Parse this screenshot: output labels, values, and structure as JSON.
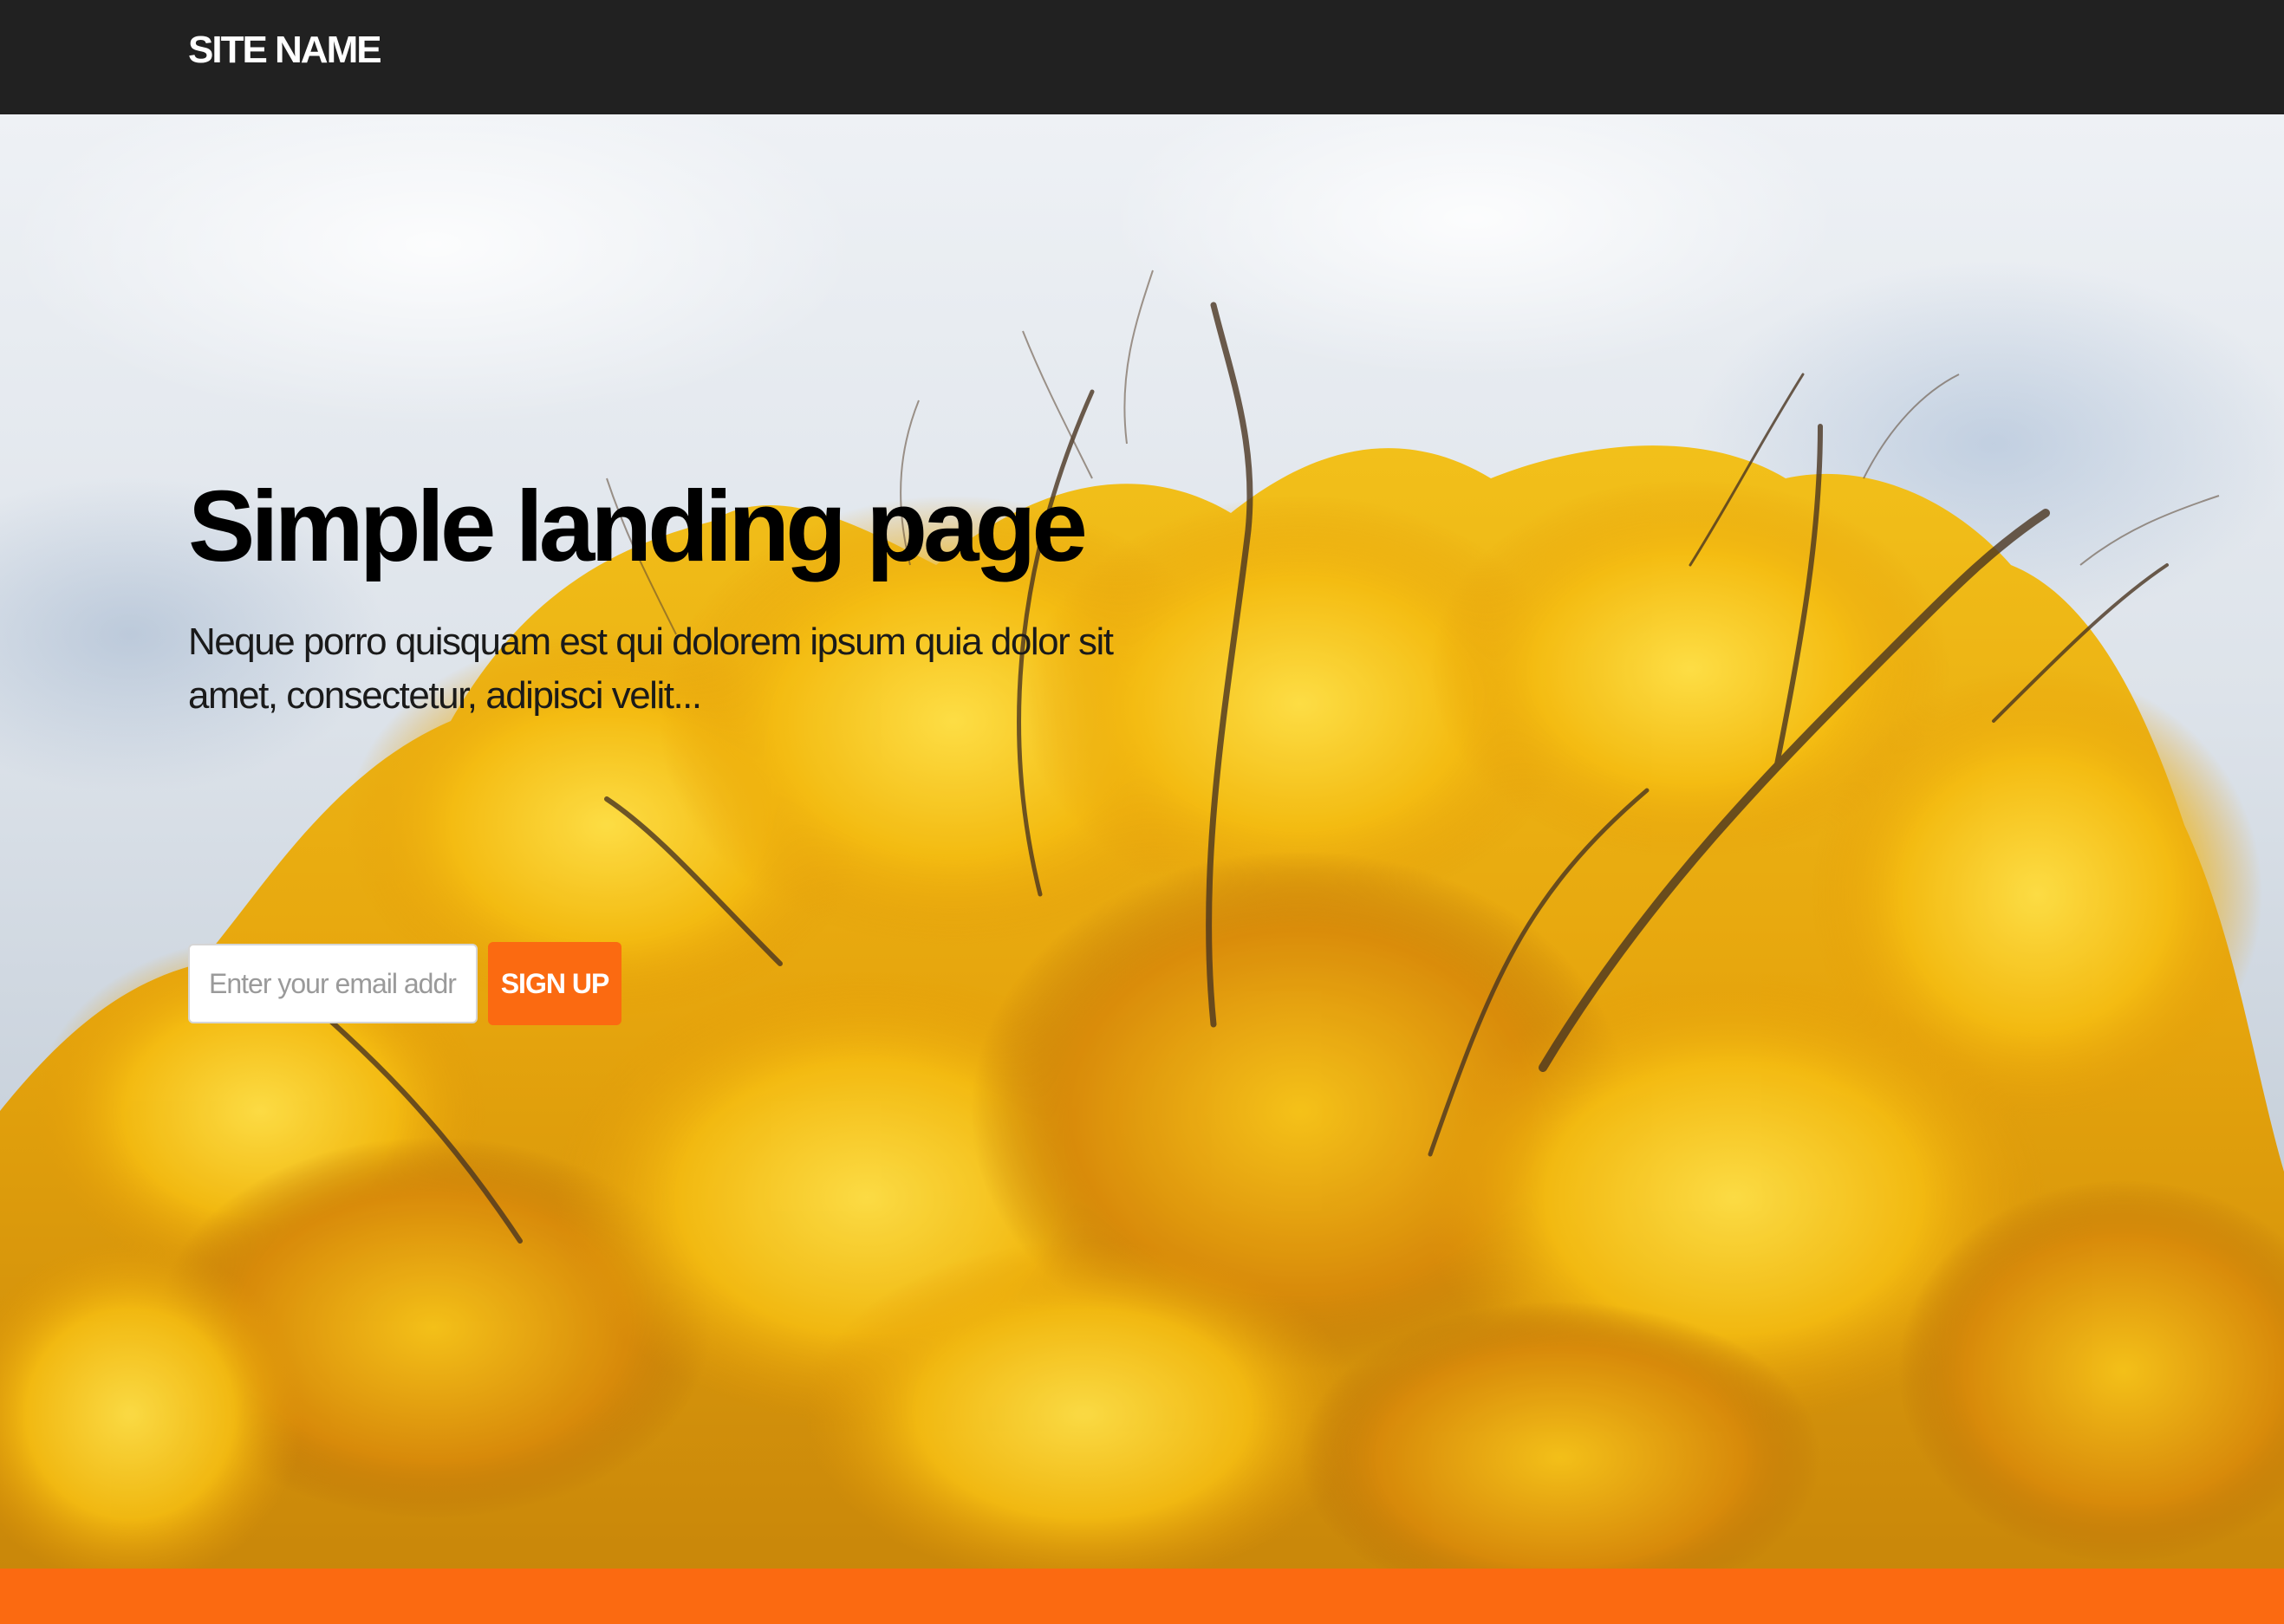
{
  "navbar": {
    "brand": "SITE NAME",
    "background_color": "#212121"
  },
  "hero": {
    "title": "Simple landing page",
    "text": "Neque porro quisquam est qui dolorem ipsum quia dolor sit amet, consectetur, adipisci velit...",
    "background_image": "yellow autumn tree against a cloudy sky",
    "signup": {
      "email_placeholder": "Enter your email address",
      "email_value": "",
      "button_label": "SIGN UP",
      "button_color": "#fb6a11"
    }
  },
  "footer": {
    "accent_color": "#fb6a11"
  }
}
